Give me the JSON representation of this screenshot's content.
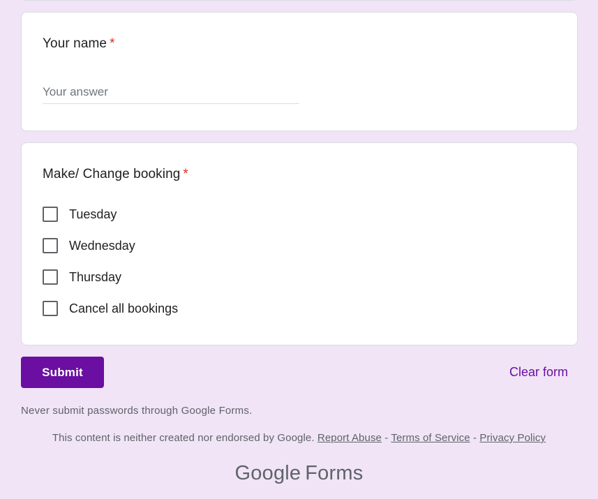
{
  "questions": {
    "name": {
      "title": "Your name",
      "required_mark": "*",
      "placeholder": "Your answer",
      "value": ""
    },
    "booking": {
      "title": "Make/ Change booking",
      "required_mark": "*",
      "options": [
        {
          "label": "Tuesday",
          "checked": false
        },
        {
          "label": "Wednesday",
          "checked": false
        },
        {
          "label": "Thursday",
          "checked": false
        },
        {
          "label": "Cancel all bookings",
          "checked": false
        }
      ]
    }
  },
  "actions": {
    "submit_label": "Submit",
    "clear_label": "Clear form"
  },
  "footer": {
    "warning": "Never submit passwords through Google Forms.",
    "disclaimer": "This content is neither created nor endorsed by Google.",
    "report_abuse": "Report Abuse",
    "separator": "-",
    "terms": "Terms of Service",
    "privacy": "Privacy Policy"
  },
  "brand": {
    "google": "Google",
    "product": "Forms"
  },
  "colors": {
    "background": "#f0e4f6",
    "accent": "#6a0fa1",
    "required": "#d93025"
  }
}
